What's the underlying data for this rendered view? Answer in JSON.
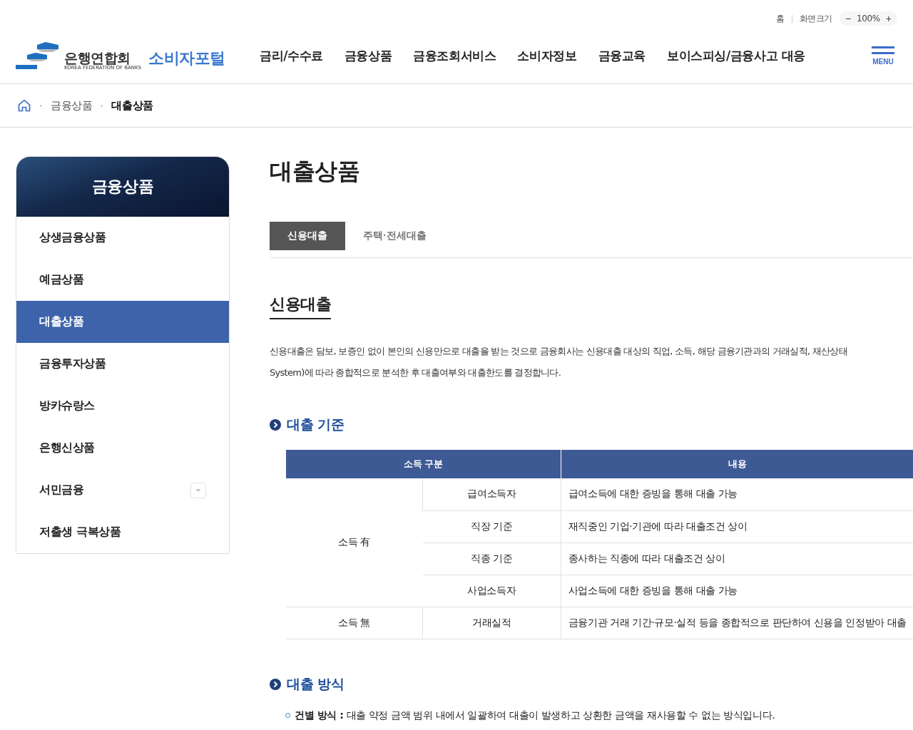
{
  "utility_links": [
    {
      "label": "홈"
    },
    {
      "label": "화면크기"
    }
  ],
  "zoom": {
    "minus": "−",
    "value": "100%",
    "plus": "+"
  },
  "logo": {
    "org": "은행연합회",
    "org_en": "KOREA FEDERATION OF BANKS",
    "portal": "소비자포털"
  },
  "nav": [
    "금리/수수료",
    "금융상품",
    "금융조회서비스",
    "소비자정보",
    "금융교육",
    "보이스피싱/금융사고 대응"
  ],
  "menu_label": "MENU",
  "breadcrumb": [
    {
      "label": "금융상품",
      "current": false
    },
    {
      "label": "대출상품",
      "current": true
    }
  ],
  "sidebar": {
    "title": "금융상품",
    "items": [
      {
        "label": "상생금융상품",
        "selected": false,
        "has_submenu": false
      },
      {
        "label": "예금상품",
        "selected": false,
        "has_submenu": false
      },
      {
        "label": "대출상품",
        "selected": true,
        "has_submenu": false
      },
      {
        "label": "금융투자상품",
        "selected": false,
        "has_submenu": false
      },
      {
        "label": "방카슈랑스",
        "selected": false,
        "has_submenu": false
      },
      {
        "label": "은행신상품",
        "selected": false,
        "has_submenu": false
      },
      {
        "label": "서민금융",
        "selected": false,
        "has_submenu": true
      },
      {
        "label": "저출생 극복상품",
        "selected": false,
        "has_submenu": false
      }
    ]
  },
  "page_title": "대출상품",
  "tabs": [
    {
      "label": "신용대출",
      "selected": true
    },
    {
      "label": "주택·전세대출",
      "selected": false
    }
  ],
  "section_title": "신용대출",
  "intro": [
    "신용대출은 담보, 보증인 없이 본인의 신용만으로 대출을 받는 것으로 금융회사는 신용대출 대상의 직업, 소득, 해당 금융기관과의 거래실적, 재산상태",
    "System)에 따라 종합적으로 분석한 후 대출여부와 대출한도를 결정합니다."
  ],
  "criteria": {
    "heading": "대출 기준",
    "columns": [
      "소득 구분",
      "내용"
    ],
    "groups": [
      {
        "label": "소득 有",
        "rows": [
          {
            "type": "급여소득자",
            "content": "급여소득에 대한 증빙을 통해 대출 가능"
          },
          {
            "type": "직장 기준",
            "content": "재직중인 기업·기관에 따라 대출조건 상이"
          },
          {
            "type": "직종 기준",
            "content": "종사하는 직종에 따라 대출조건 상이"
          },
          {
            "type": "사업소득자",
            "content": "사업소득에 대한 증빙을 통해 대출 가능"
          }
        ]
      },
      {
        "label": "소득 無",
        "rows": [
          {
            "type": "거래실적",
            "content": "금융기관 거래 기간·규모·실적 등을 종합적으로 판단하여 신용을 인정받아 대출"
          }
        ]
      }
    ]
  },
  "method": {
    "heading": "대출 방식",
    "items": [
      {
        "term": "건별 방식 :",
        "text": "대출 약정 금액 범위 내에서 일괄하여 대출이 발생하고 상환한 금액을 재사용할 수 없는 방식입니다."
      }
    ]
  }
}
